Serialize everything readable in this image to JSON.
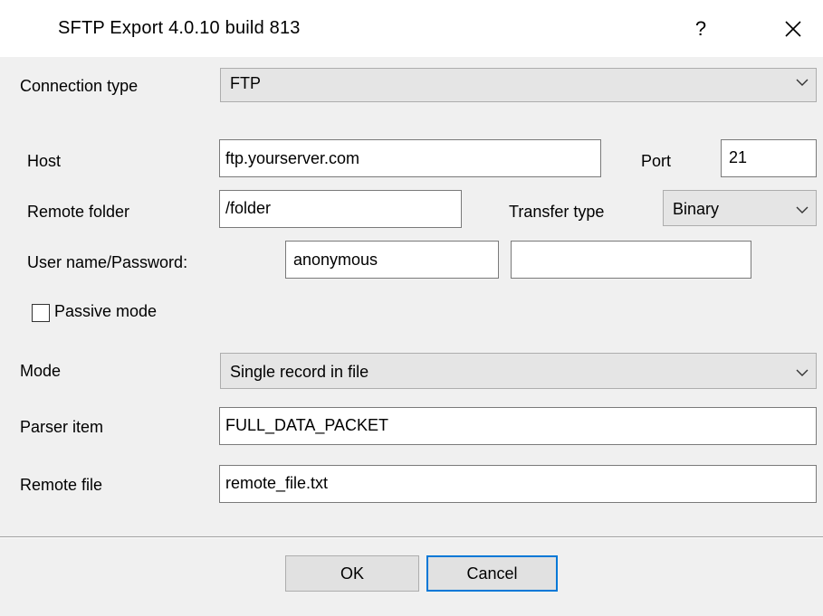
{
  "window": {
    "title": "SFTP Export 4.0.10 build 813",
    "help_label": "?",
    "close_label": "✕"
  },
  "form": {
    "connection_type": {
      "label": "Connection type",
      "value": "FTP"
    },
    "host": {
      "label": "Host",
      "value": "ftp.yourserver.com"
    },
    "port": {
      "label": "Port",
      "value": "21"
    },
    "remote_folder": {
      "label": "Remote folder",
      "value": "/folder"
    },
    "transfer_type": {
      "label": "Transfer type",
      "value": "Binary"
    },
    "credentials": {
      "label": "User name/Password:",
      "user": "anonymous",
      "password": ""
    },
    "passive_mode": {
      "label": "Passive mode",
      "checked": false
    },
    "mode": {
      "label": "Mode",
      "value": "Single record in file"
    },
    "parser_item": {
      "label": "Parser item",
      "value": "FULL_DATA_PACKET"
    },
    "remote_file": {
      "label": "Remote file",
      "value": "remote_file.txt"
    }
  },
  "buttons": {
    "ok": "OK",
    "cancel": "Cancel"
  },
  "icons": {
    "chevron": "chevron-down-icon",
    "close": "close-icon",
    "help": "help-icon"
  },
  "colors": {
    "accent": "#0078d7",
    "background": "#f0f0f0",
    "combo": "#e5e5e5"
  }
}
